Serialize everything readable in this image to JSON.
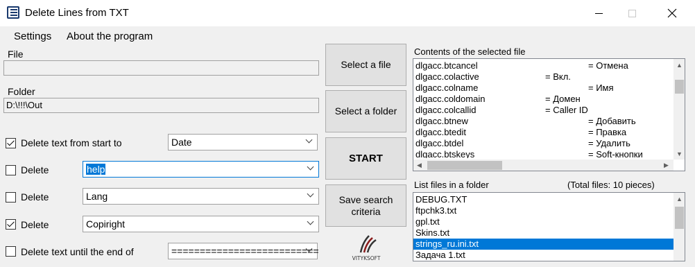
{
  "window": {
    "title": "Delete Lines from TXT",
    "icon": "list-icon"
  },
  "menu": {
    "settings": "Settings",
    "about": "About the program"
  },
  "file": {
    "label": "File",
    "value": ""
  },
  "folder": {
    "label": "Folder",
    "value": "D:\\!!!\\Out"
  },
  "options": [
    {
      "checked": true,
      "label": "Delete text from start to",
      "combo_value": "Date"
    },
    {
      "checked": false,
      "label": "Delete",
      "combo_value": "help"
    },
    {
      "checked": false,
      "label": "Delete",
      "combo_value": "Lang"
    },
    {
      "checked": true,
      "label": "Delete",
      "combo_value": "Copiright"
    },
    {
      "checked": false,
      "label": "Delete text until the end of",
      "combo_value": "=========================="
    }
  ],
  "buttons": {
    "select_file": "Select a file",
    "select_folder": "Select a folder",
    "start": "START",
    "save_criteria": "Save search criteria"
  },
  "logo_text": "VITYKSOFT",
  "contents": {
    "label": "Contents of the selected file",
    "lines": [
      {
        "key": "dlgacc.btcancel",
        "value": "= Отмена"
      },
      {
        "key": "dlgacc.colactive",
        "value": "= Вкл."
      },
      {
        "key": "dlgacc.colname",
        "value": "= Имя"
      },
      {
        "key": "dlgacc.coldomain",
        "value": "= Домен"
      },
      {
        "key": "dlgacc.colcallid",
        "value": "= Caller ID"
      },
      {
        "key": "dlgacc.btnew",
        "value": "= Добавить"
      },
      {
        "key": "dlgacc.btedit",
        "value": "= Правка"
      },
      {
        "key": "dlgacc.btdel",
        "value": "= Удалить"
      },
      {
        "key": "dlgacc.btskeys",
        "value": "= Soft-кнопки"
      }
    ]
  },
  "files": {
    "label": "List files in a folder",
    "total": "(Total files: 10 pieces)",
    "items": [
      "DEBUG.TXT",
      "ftpchk3.txt",
      "gpl.txt",
      "Skins.txt",
      "strings_ru.ini.txt",
      "Задача 1.txt"
    ],
    "selected_index": 4
  }
}
